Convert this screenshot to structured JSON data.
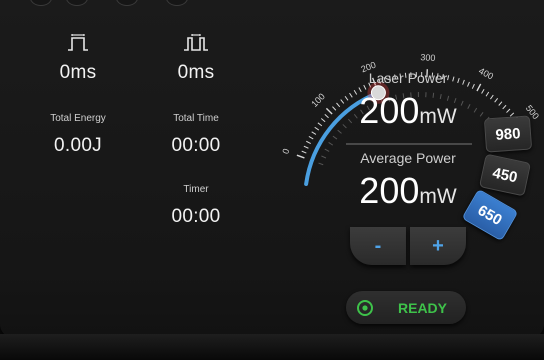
{
  "stats": {
    "pulse_width": "0ms",
    "pulse_interval": "0ms",
    "total_energy_label": "Total Energy",
    "total_energy": "0.00J",
    "total_time_label": "Total Time",
    "total_time": "00:00",
    "timer_label": "Timer",
    "timer": "00:00"
  },
  "gauge": {
    "ticks": [
      "0",
      "100",
      "200",
      "300",
      "400",
      "500"
    ],
    "scale_min": 0,
    "scale_max": 500,
    "value": 200,
    "arc_color": "#4a9fe0",
    "knob_color": "#e04040"
  },
  "laser_power": {
    "label": "Laser Power",
    "value": "200",
    "unit": "mW"
  },
  "average_power": {
    "label": "Average Power",
    "value": "200",
    "unit": "mW"
  },
  "wavelengths": [
    {
      "label": "980",
      "active": false
    },
    {
      "label": "450",
      "active": false
    },
    {
      "label": "650",
      "active": true
    }
  ],
  "buttons": {
    "minus": "-",
    "plus": "+"
  },
  "status": {
    "label": "READY",
    "color": "#3ec24a"
  }
}
